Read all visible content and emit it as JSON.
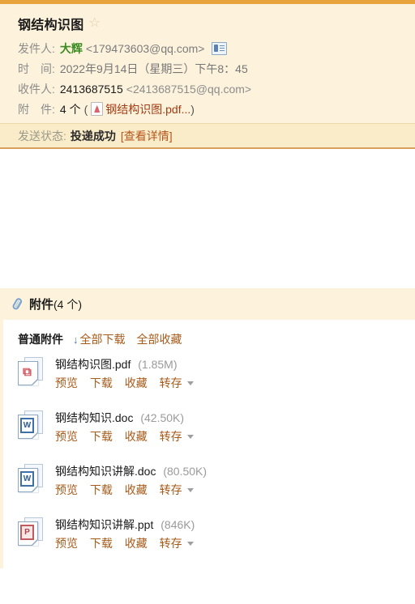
{
  "top_bar_color": "#e8a33d",
  "mail": {
    "subject": "钢结构识图",
    "star_glyph": "☆",
    "fields": {
      "sender_label": "发件人:",
      "sender_name": "大辉",
      "sender_email": "<179473603@qq.com>",
      "time_label": "时　间:",
      "time_value": "2022年9月14日（星期三）下午8：45",
      "recipient_label": "收件人:",
      "recipient_name": "2413687515",
      "recipient_email": "<2413687515@qq.com>",
      "attachment_label": "附　件:",
      "attachment_count": "4 个",
      "attachment_open_paren": "(",
      "attachment_first_name": "钢结构识图.pdf...",
      "attachment_close_paren": ")"
    },
    "status": {
      "label": "发送状态:",
      "value": "投递成功",
      "detail_link": "[查看详情]"
    }
  },
  "attachments_panel": {
    "title": "附件",
    "count_text": "(4 个)",
    "group_title": "普通附件",
    "download_arrow": "↓",
    "download_all": "全部下载",
    "favorite_all": "全部收藏",
    "items": [
      {
        "name": "钢结构识图.pdf",
        "size": "(1.85M)",
        "type": "pdf",
        "badge": "",
        "actions": [
          "预览",
          "下载",
          "收藏",
          "转存"
        ]
      },
      {
        "name": "钢结构知识.doc",
        "size": "(42.50K)",
        "type": "doc",
        "badge": "W",
        "actions": [
          "预览",
          "下载",
          "收藏",
          "转存"
        ]
      },
      {
        "name": "钢结构知识讲解.doc",
        "size": "(80.50K)",
        "type": "doc",
        "badge": "W",
        "actions": [
          "预览",
          "下载",
          "收藏",
          "转存"
        ]
      },
      {
        "name": "钢结构知识讲解.ppt",
        "size": "(846K)",
        "type": "ppt",
        "badge": "P",
        "actions": [
          "预览",
          "下载",
          "收藏",
          "转存"
        ]
      }
    ]
  }
}
